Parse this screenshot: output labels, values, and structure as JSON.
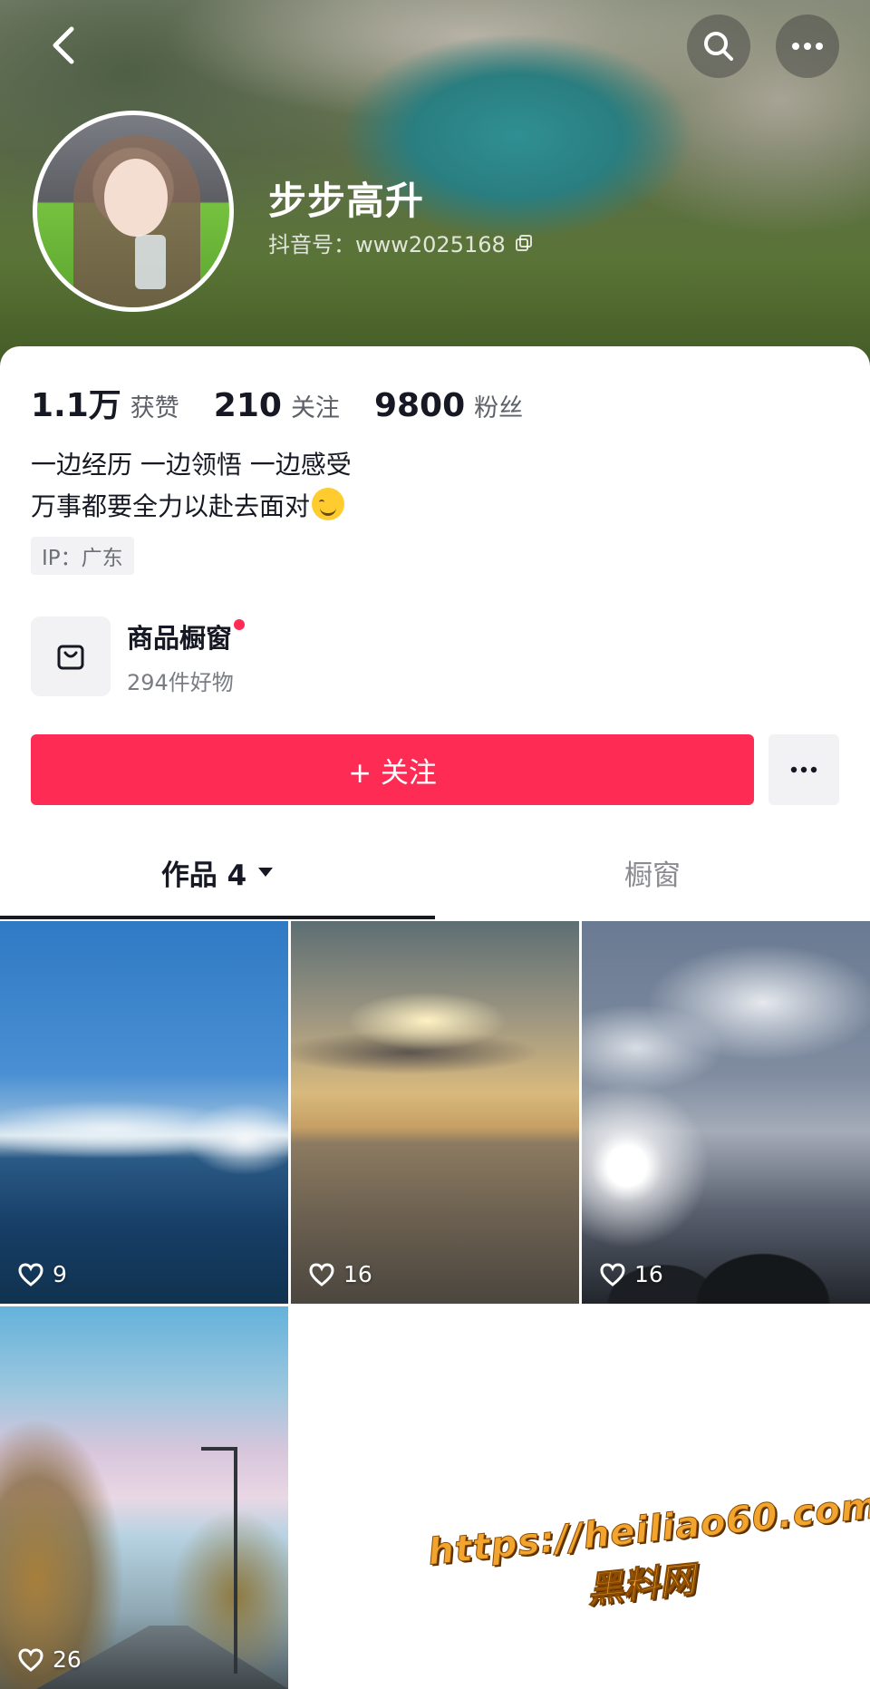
{
  "header": {
    "nickname": "步步高升",
    "douyin_id": "抖音号：www2025168",
    "icons": [
      "back-icon",
      "search-icon",
      "more-icon",
      "copy-icon"
    ]
  },
  "stats": [
    {
      "value": "1.1万",
      "label": "获赞"
    },
    {
      "value": "210",
      "label": "关注"
    },
    {
      "value": "9800",
      "label": "粉丝"
    }
  ],
  "bio": {
    "line1": "一边经历 一边领悟 一边感受",
    "line2": "万事都要全力以赴去面对"
  },
  "ip_tag": "IP：广东",
  "shop": {
    "title": "商品橱窗",
    "subtitle": "294件好物"
  },
  "follow_button": "+ 关注",
  "tabs": {
    "works": "作品 4",
    "shop": "橱窗"
  },
  "videos": [
    {
      "likes": "9"
    },
    {
      "likes": "16"
    },
    {
      "likes": "16"
    },
    {
      "likes": "26"
    }
  ],
  "watermark": {
    "url": "https://heiliao60.com",
    "name": "黑料网"
  },
  "colors": {
    "accent": "#fe2c55",
    "text": "#161823",
    "muted": "#7a7c83"
  }
}
